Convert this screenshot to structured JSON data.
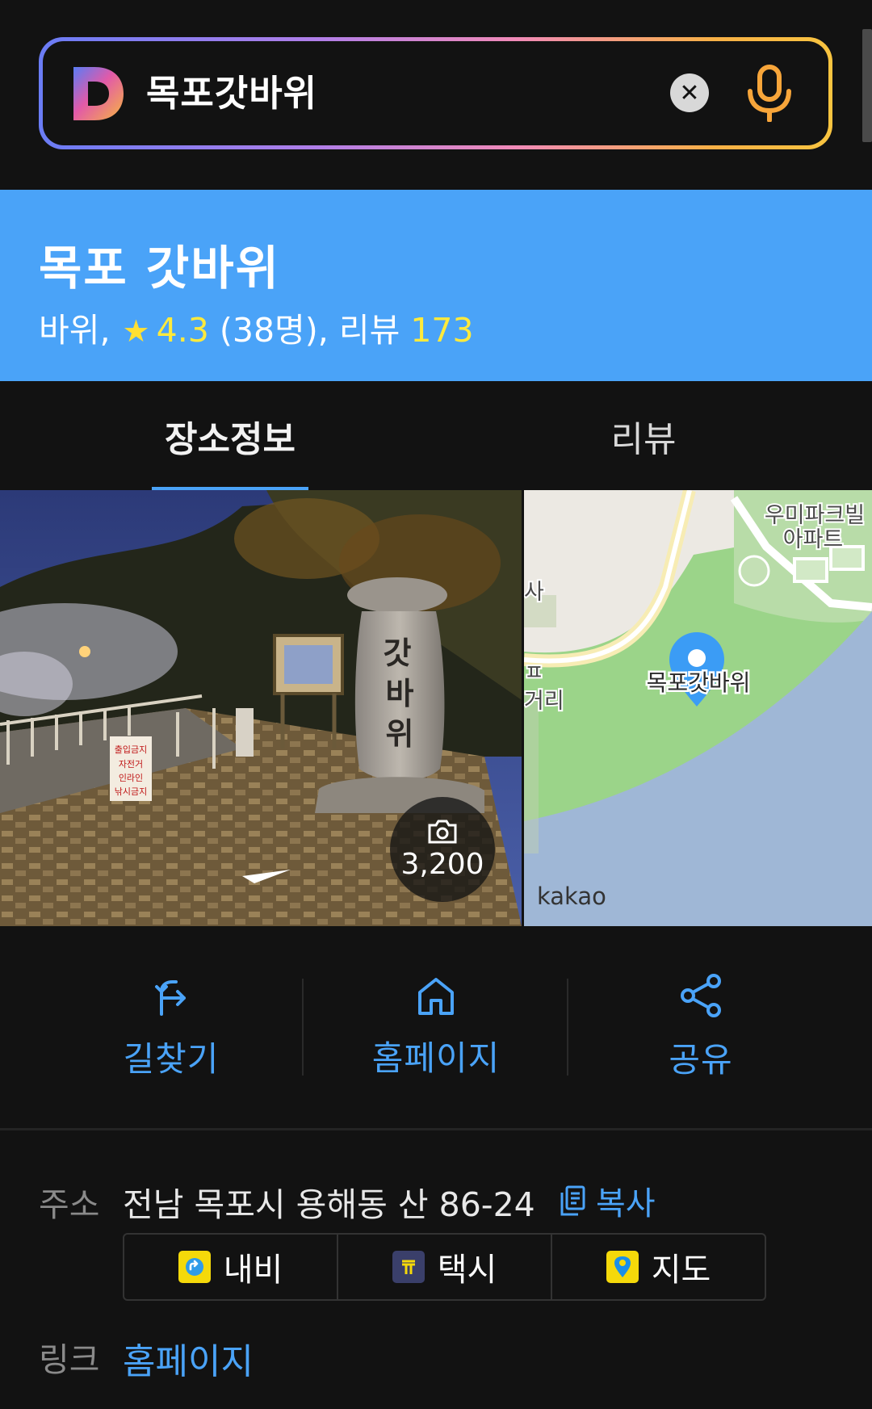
{
  "search": {
    "query": "목포갓바위",
    "logo_letter": "D",
    "clear_icon": "close-icon",
    "mic_icon": "microphone-icon",
    "gradient_colors": [
      "#6a7cf5",
      "#b07ee8",
      "#f08ab8",
      "#f7b046",
      "#f8c440"
    ]
  },
  "place": {
    "title": "목포 갓바위",
    "category": "바위,",
    "rating": "4.3",
    "rating_count": "(38명),",
    "review_label": "리뷰",
    "review_count": "173",
    "panel_color": "#4aa3f8",
    "accent_yellow": "#ffea3c"
  },
  "tabs": [
    {
      "label": "장소정보",
      "active": true
    },
    {
      "label": "리뷰",
      "active": false
    }
  ],
  "media": {
    "photo_count": "3,200",
    "photo_sign": [
      "갓",
      "바",
      "위"
    ],
    "photo_warning_sign": [
      "출입금지",
      "자전거",
      "인라인",
      "낚시금지"
    ],
    "map_labels": {
      "apartment": "우미파크빌",
      "apartment2": "아파트",
      "pin_label": "목포갓바위",
      "left_edge_1": "사",
      "left_edge_2": "ㅍ",
      "left_edge_3": "거리",
      "brand": "kakao"
    }
  },
  "actions": [
    {
      "label": "길찾기",
      "icon": "directions-icon"
    },
    {
      "label": "홈페이지",
      "icon": "home-icon"
    },
    {
      "label": "공유",
      "icon": "share-icon"
    }
  ],
  "details": {
    "address_label": "주소",
    "address": "전남 목포시 용해동 산 86-24",
    "copy_label": "복사",
    "route_buttons": [
      {
        "label": "내비",
        "icon": "navi-icon",
        "color": "#f5d90a"
      },
      {
        "label": "택시",
        "icon": "taxi-icon",
        "color": "#3a3f6a"
      },
      {
        "label": "지도",
        "icon": "map-pin-icon",
        "color": "#f5d90a"
      }
    ],
    "link_label": "링크",
    "link_text": "홈페이지"
  }
}
